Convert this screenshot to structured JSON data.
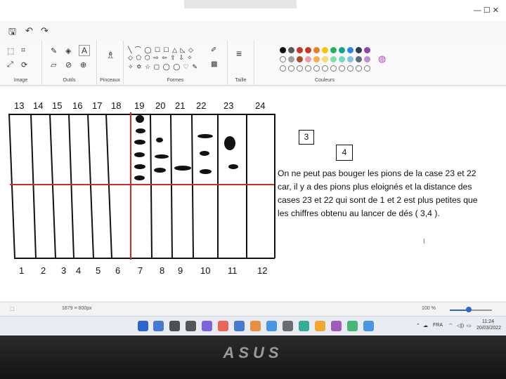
{
  "window": {
    "title_controls": "—   ☐   ✕"
  },
  "ribbon": {
    "groups": [
      {
        "label": "Image"
      },
      {
        "label": "Outils"
      },
      {
        "label": "Pinceaux"
      },
      {
        "label": "Formes"
      },
      {
        "label": "Taille"
      },
      {
        "label": "Couleurs"
      }
    ],
    "shapes_row1": "╲ ⌒ ◯ ☐ ☐ △ ◺ ◇",
    "shapes_row2": "◇ ⬠ ⬡ ⇨ ⇦ ⇧ ⇩ ✧",
    "shapes_row3": "✧ ✡ ☆ ▢ ◯ ◯ ♡ ✎",
    "colors_top": [
      "#111111",
      "#5a5a5a",
      "#c0392b",
      "#c0392b",
      "#e67e22",
      "#f1c40f",
      "#27ae60",
      "#16a085",
      "#2e86de",
      "#2c3e50",
      "#8e44ad"
    ],
    "colors_mid": [
      "#ffffff",
      "#9aa0a6",
      "#a0522d",
      "#e8a0b0",
      "#f5b041",
      "#f7dc6f",
      "#82e0aa",
      "#76d7c4",
      "#85c1e9",
      "#5d6d7e",
      "#bb8fce"
    ],
    "empty_count": 11
  },
  "board": {
    "top_numbers": [
      "13",
      "14",
      "15",
      "16",
      "17",
      "18",
      "19",
      "20",
      "21",
      "22",
      "23",
      "24"
    ],
    "bottom_numbers": [
      "1",
      "2",
      "3",
      "4",
      "5",
      "6",
      "7",
      "8",
      "9",
      "10",
      "11",
      "12"
    ]
  },
  "boxes": {
    "box1": "3",
    "box2": "4"
  },
  "note_lines": [
    "On ne peut pas bouger les pions de la case 23 et 22",
    "car, il y a des pions plus eloignés et la distance des",
    "cases 23 et 22 qui sont de 1 et 2 est plus petites que",
    "les chiffres obtenu au lancer de dés ( 3,4 )."
  ],
  "statusbar": {
    "canvas_size": "1879 × 800px",
    "zoom_label": "100 %",
    "zoom_fraction": 0.45
  },
  "taskbar": {
    "lang": "FRA",
    "time": "11:24",
    "date": "20/03/2022",
    "app_colors": [
      "#2b66c9",
      "#333333",
      "#3b3b3b",
      "#6b4bd6",
      "#e74c3c",
      "#2b66c9",
      "#e67e22",
      "#2e86de",
      "#555555",
      "#16a085",
      "#f39c12",
      "#8e44ad",
      "#27ae60",
      "#2e86de"
    ]
  },
  "brand": "ASUS"
}
